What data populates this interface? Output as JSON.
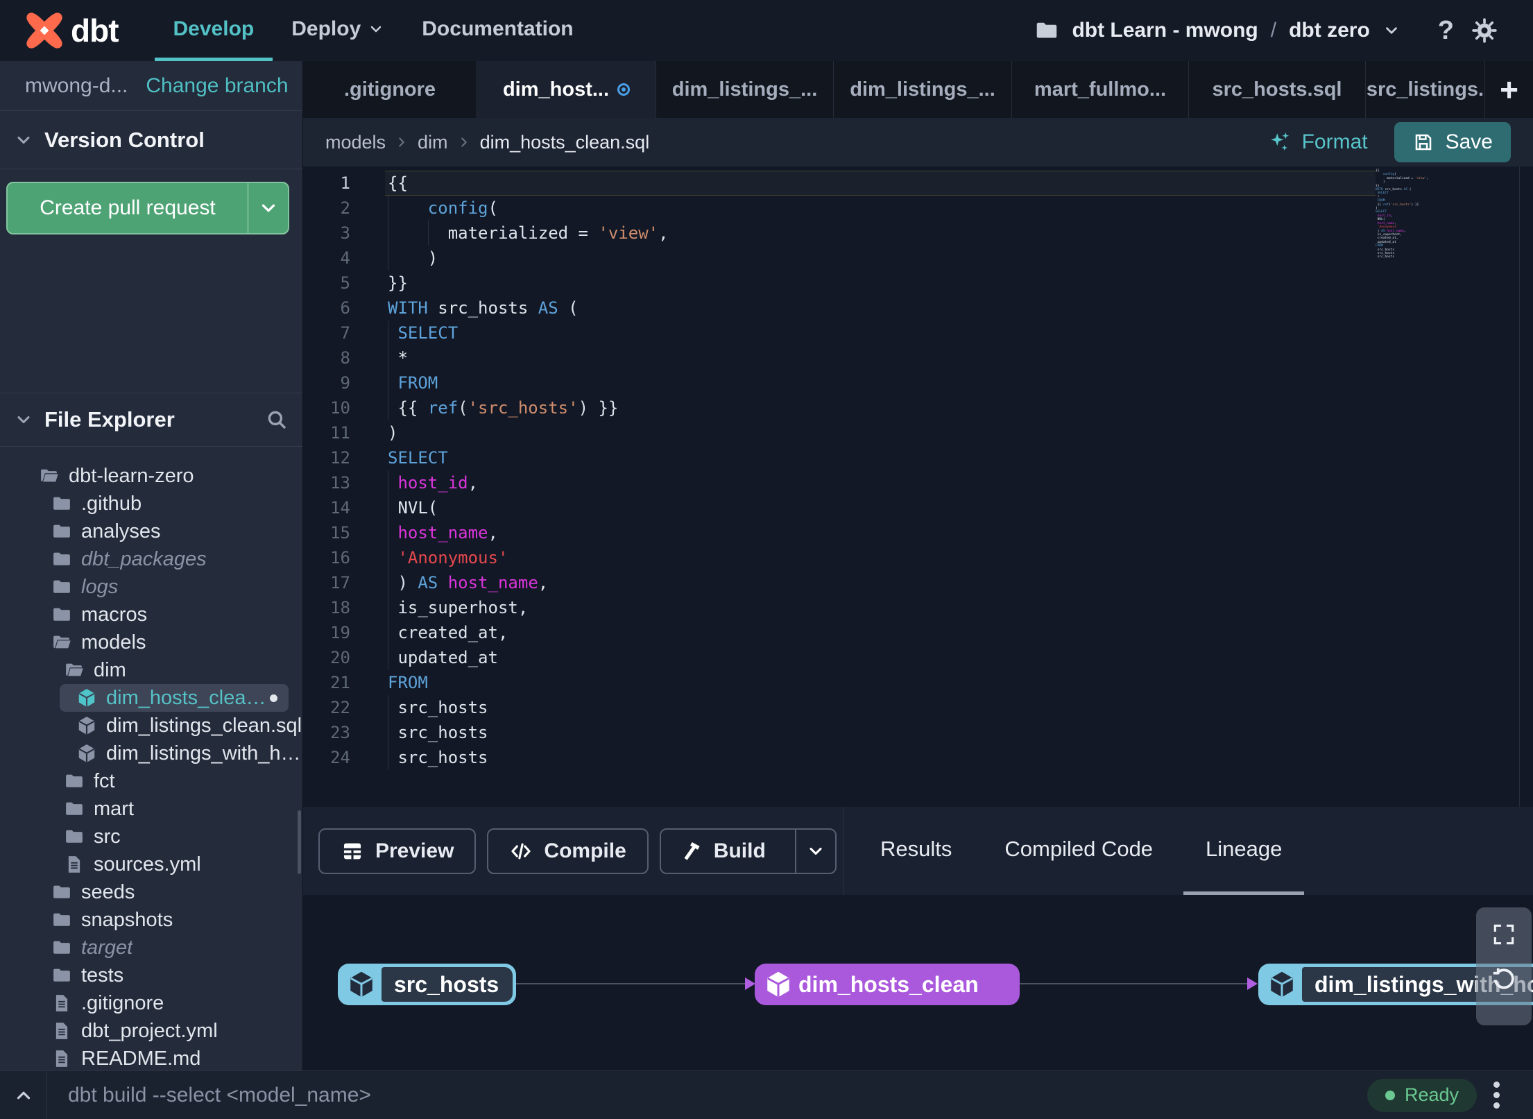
{
  "app": {
    "logo_text": "dbt"
  },
  "nav": {
    "develop": "Develop",
    "deploy": "Deploy",
    "documentation": "Documentation",
    "account": "dbt Learn - mwong",
    "separator": "/",
    "project": "dbt zero",
    "help_glyph": "?"
  },
  "sidebar": {
    "branch_name": "mwong-d...",
    "change_branch": "Change branch",
    "version_control": "Version Control",
    "create_pr": "Create pull request",
    "file_explorer": "File Explorer",
    "tree": [
      {
        "name": "dbt-learn-zero",
        "icon": "folder-open",
        "depth": 0
      },
      {
        "name": ".github",
        "icon": "folder",
        "depth": 1
      },
      {
        "name": "analyses",
        "icon": "folder",
        "depth": 1
      },
      {
        "name": "dbt_packages",
        "icon": "folder",
        "depth": 1,
        "italic": true
      },
      {
        "name": "logs",
        "icon": "folder",
        "depth": 1,
        "italic": true
      },
      {
        "name": "macros",
        "icon": "folder",
        "depth": 1
      },
      {
        "name": "models",
        "icon": "folder-open",
        "depth": 1
      },
      {
        "name": "dim",
        "icon": "folder-open",
        "depth": 2
      },
      {
        "name": "dim_hosts_clean.sql",
        "icon": "cube",
        "depth": 3,
        "selected": true,
        "modified": true
      },
      {
        "name": "dim_listings_clean.sql",
        "icon": "cube",
        "depth": 3
      },
      {
        "name": "dim_listings_with_hosts...",
        "icon": "cube",
        "depth": 3
      },
      {
        "name": "fct",
        "icon": "folder",
        "depth": 2
      },
      {
        "name": "mart",
        "icon": "folder",
        "depth": 2
      },
      {
        "name": "src",
        "icon": "folder",
        "depth": 2
      },
      {
        "name": "sources.yml",
        "icon": "file",
        "depth": 2
      },
      {
        "name": "seeds",
        "icon": "folder",
        "depth": 1
      },
      {
        "name": "snapshots",
        "icon": "folder",
        "depth": 1
      },
      {
        "name": "target",
        "icon": "folder",
        "depth": 1,
        "italic": true
      },
      {
        "name": "tests",
        "icon": "folder",
        "depth": 1
      },
      {
        "name": ".gitignore",
        "icon": "file",
        "depth": 1
      },
      {
        "name": "dbt_project.yml",
        "icon": "file",
        "depth": 1
      },
      {
        "name": "README.md",
        "icon": "file",
        "depth": 1
      }
    ]
  },
  "tabs": {
    "items": [
      {
        "label": ".gitignore"
      },
      {
        "label": "dim_host...",
        "active": true,
        "modified": true
      },
      {
        "label": "dim_listings_..."
      },
      {
        "label": "dim_listings_..."
      },
      {
        "label": "mart_fullmo..."
      },
      {
        "label": "src_hosts.sql"
      },
      {
        "label": "src_listings."
      }
    ],
    "add_glyph": "+"
  },
  "breadcrumb": {
    "path": [
      "models",
      "dim",
      "dim_hosts_clean.sql"
    ],
    "format_label": "Format",
    "save_label": "Save"
  },
  "editor": {
    "lines": [
      {
        "n": 1,
        "hl": true,
        "seg": [
          [
            "{{",
            "p"
          ]
        ]
      },
      {
        "n": 2,
        "g": [
          0
        ],
        "seg": [
          [
            "    ",
            "p"
          ],
          [
            "config",
            "k"
          ],
          [
            "(",
            "p"
          ]
        ]
      },
      {
        "n": 3,
        "g": [
          0,
          4
        ],
        "seg": [
          [
            "      materialized = ",
            "p"
          ],
          [
            "'view'",
            "s"
          ],
          [
            ",",
            "p"
          ]
        ]
      },
      {
        "n": 4,
        "g": [
          0
        ],
        "seg": [
          [
            "    )",
            "p"
          ]
        ]
      },
      {
        "n": 5,
        "seg": [
          [
            "}}",
            "p"
          ]
        ]
      },
      {
        "n": 6,
        "seg": [
          [
            "WITH",
            "k"
          ],
          [
            " src_hosts ",
            "p"
          ],
          [
            "AS",
            "k"
          ],
          [
            " (",
            "p"
          ]
        ]
      },
      {
        "n": 7,
        "g": [
          0
        ],
        "seg": [
          [
            " ",
            "p"
          ],
          [
            "SELECT",
            "k"
          ]
        ]
      },
      {
        "n": 8,
        "g": [
          0
        ],
        "seg": [
          [
            " *",
            "p"
          ]
        ]
      },
      {
        "n": 9,
        "g": [
          0
        ],
        "seg": [
          [
            " ",
            "p"
          ],
          [
            "FROM",
            "k"
          ]
        ]
      },
      {
        "n": 10,
        "g": [
          0
        ],
        "seg": [
          [
            " {{ ",
            "p"
          ],
          [
            "ref",
            "k"
          ],
          [
            "(",
            "p"
          ],
          [
            "'src_hosts'",
            "s"
          ],
          [
            ") }}",
            "p"
          ]
        ]
      },
      {
        "n": 11,
        "seg": [
          [
            ")",
            "p"
          ]
        ]
      },
      {
        "n": 12,
        "seg": [
          [
            "SELECT",
            "k"
          ]
        ]
      },
      {
        "n": 13,
        "g": [
          0
        ],
        "seg": [
          [
            " ",
            "p"
          ],
          [
            "host_id",
            "m"
          ],
          [
            ",",
            "p"
          ]
        ]
      },
      {
        "n": 14,
        "g": [
          0
        ],
        "seg": [
          [
            " NVL(",
            "p"
          ]
        ]
      },
      {
        "n": 15,
        "g": [
          0
        ],
        "seg": [
          [
            " ",
            "p"
          ],
          [
            "host_name",
            "m"
          ],
          [
            ",",
            "p"
          ]
        ]
      },
      {
        "n": 16,
        "g": [
          0
        ],
        "seg": [
          [
            " ",
            "p"
          ],
          [
            "'Anonymous'",
            "r"
          ]
        ]
      },
      {
        "n": 17,
        "g": [
          0
        ],
        "seg": [
          [
            " ) ",
            "p"
          ],
          [
            "AS",
            "k"
          ],
          [
            " ",
            "p"
          ],
          [
            "host_name",
            "m"
          ],
          [
            ",",
            "p"
          ]
        ]
      },
      {
        "n": 18,
        "g": [
          0
        ],
        "seg": [
          [
            " is_superhost,",
            "p"
          ]
        ]
      },
      {
        "n": 19,
        "g": [
          0
        ],
        "seg": [
          [
            " created_at,",
            "p"
          ]
        ]
      },
      {
        "n": 20,
        "g": [
          0
        ],
        "seg": [
          [
            " updated_at",
            "p"
          ]
        ]
      },
      {
        "n": 21,
        "seg": [
          [
            "FROM",
            "k"
          ]
        ]
      },
      {
        "n": 22,
        "g": [
          0
        ],
        "seg": [
          [
            " src_hosts",
            "p"
          ]
        ]
      },
      {
        "n": 23,
        "g": [
          0
        ],
        "seg": [
          [
            " src_hosts",
            "p"
          ]
        ]
      },
      {
        "n": 24,
        "g": [
          0
        ],
        "seg": [
          [
            " src_hosts",
            "p"
          ]
        ]
      }
    ]
  },
  "panel": {
    "preview": "Preview",
    "compile": "Compile",
    "build": "Build",
    "tabs": [
      {
        "label": "Results"
      },
      {
        "label": "Compiled Code"
      },
      {
        "label": "Lineage",
        "active": true
      }
    ]
  },
  "lineage": {
    "nodes": [
      {
        "label": "src_hosts",
        "kind": "source"
      },
      {
        "label": "dim_hosts_clean",
        "kind": "selected"
      },
      {
        "label": "dim_listings_with_hosts",
        "kind": "source"
      }
    ]
  },
  "statusbar": {
    "command": "dbt build --select <model_name>",
    "ready": "Ready"
  },
  "colors": {
    "accent_teal": "#53C1C6",
    "green_button": "#4EA375",
    "save_button": "#2E6C72",
    "node_blue": "#7FC9E5",
    "node_purple": "#AA58DC",
    "ready_green": "#6AC991",
    "keyword_blue": "#5EA3DA",
    "string_orange": "#CF8D6C",
    "string_red": "#E5484D",
    "identifier_magenta": "#DA35DA"
  }
}
